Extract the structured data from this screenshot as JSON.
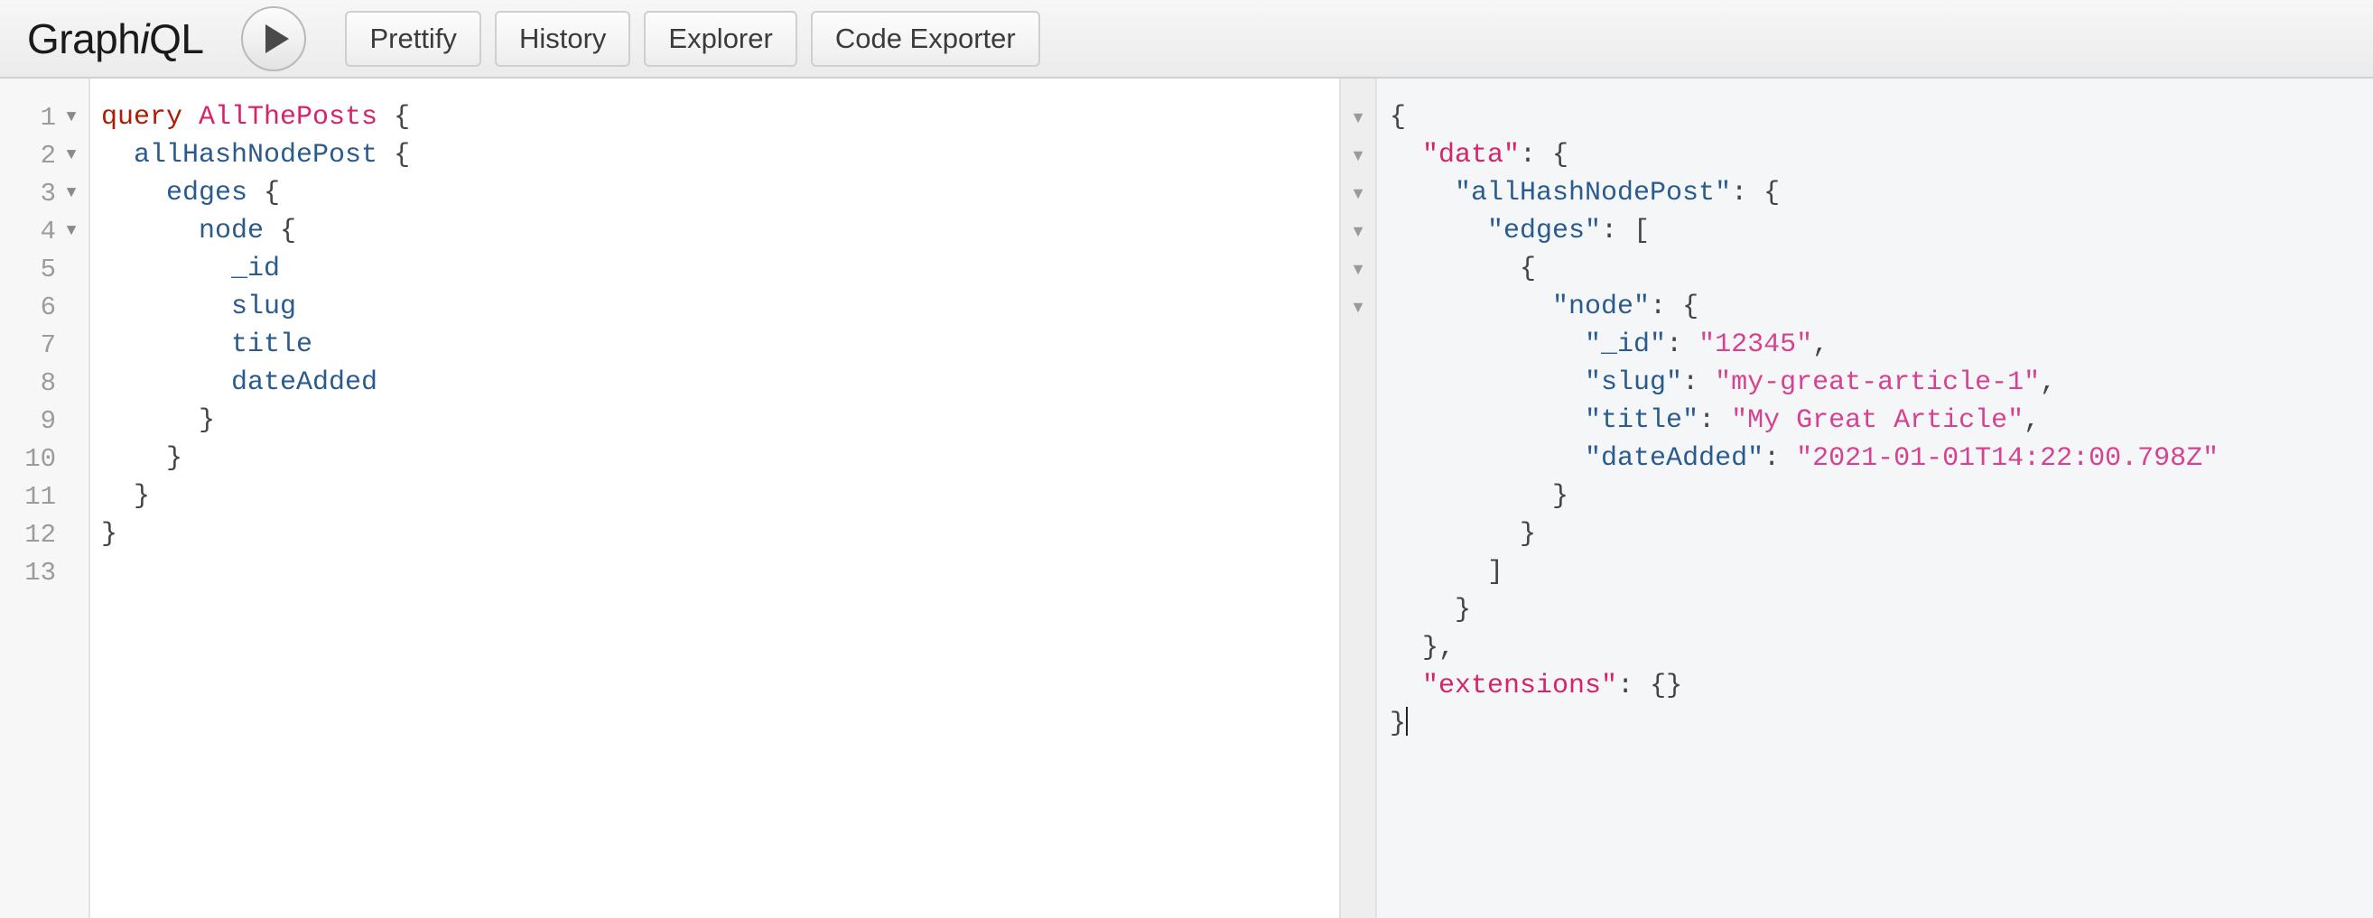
{
  "app": {
    "brand_prefix": "Graph",
    "brand_italic": "i",
    "brand_suffix": "QL"
  },
  "toolbar": {
    "execute_icon": "play-triangle-icon",
    "buttons": [
      {
        "label": "Prettify"
      },
      {
        "label": "History"
      },
      {
        "label": "Explorer"
      },
      {
        "label": "Code Exporter"
      }
    ]
  },
  "colors": {
    "keyword": "#b11a04",
    "operation_name": "#d6236a",
    "field": "#2a5b8f",
    "punctuation": "#444444",
    "json_top_key": "#d6236a",
    "json_nested_key": "#2a5b8f",
    "json_string": "#d64292",
    "header_bg": "#f2f2f2",
    "query_bg": "#ffffff",
    "result_bg": "#f5f6f8"
  },
  "query_editor": {
    "line_numbers": [
      "1",
      "2",
      "3",
      "4",
      "5",
      "6",
      "7",
      "8",
      "9",
      "10",
      "11",
      "12",
      "13"
    ],
    "fold_markers": [
      "▼",
      "▼",
      "▼",
      "▼",
      "",
      "",
      "",
      "",
      "",
      "",
      "",
      "",
      ""
    ],
    "lines": [
      [
        {
          "t": "query",
          "c": "kw"
        },
        {
          "t": " ",
          "c": "pn"
        },
        {
          "t": "AllThePosts",
          "c": "op"
        },
        {
          "t": " {",
          "c": "pn"
        }
      ],
      [
        {
          "t": "  ",
          "c": "pn"
        },
        {
          "t": "allHashNodePost",
          "c": "fld"
        },
        {
          "t": " {",
          "c": "pn"
        }
      ],
      [
        {
          "t": "    ",
          "c": "pn"
        },
        {
          "t": "edges",
          "c": "fld"
        },
        {
          "t": " {",
          "c": "pn"
        }
      ],
      [
        {
          "t": "      ",
          "c": "pn"
        },
        {
          "t": "node",
          "c": "fld"
        },
        {
          "t": " {",
          "c": "pn"
        }
      ],
      [
        {
          "t": "        ",
          "c": "pn"
        },
        {
          "t": "_id",
          "c": "fld"
        }
      ],
      [
        {
          "t": "        ",
          "c": "pn"
        },
        {
          "t": "slug",
          "c": "fld"
        }
      ],
      [
        {
          "t": "        ",
          "c": "pn"
        },
        {
          "t": "title",
          "c": "fld"
        }
      ],
      [
        {
          "t": "        ",
          "c": "pn"
        },
        {
          "t": "dateAdded",
          "c": "fld"
        }
      ],
      [
        {
          "t": "      }",
          "c": "pn"
        }
      ],
      [
        {
          "t": "    }",
          "c": "pn"
        }
      ],
      [
        {
          "t": "  }",
          "c": "pn"
        }
      ],
      [
        {
          "t": "}",
          "c": "pn"
        }
      ],
      []
    ],
    "plain_text": "query AllThePosts {\n  allHashNodePost {\n    edges {\n      node {\n        _id\n        slug\n        title\n        dateAdded\n      }\n    }\n  }\n}\n"
  },
  "result_viewer": {
    "fold_markers": [
      "▼",
      "▼",
      "▼",
      "▼",
      "▼",
      "▼",
      "",
      "",
      "",
      "",
      "",
      "",
      "",
      "",
      "",
      "",
      "",
      ""
    ],
    "lines": [
      [
        {
          "t": "{",
          "c": "rp"
        }
      ],
      [
        {
          "t": "  ",
          "c": "rp"
        },
        {
          "t": "\"data\"",
          "c": "key1"
        },
        {
          "t": ": {",
          "c": "rp"
        }
      ],
      [
        {
          "t": "    ",
          "c": "rp"
        },
        {
          "t": "\"allHashNodePost\"",
          "c": "key2"
        },
        {
          "t": ": {",
          "c": "rp"
        }
      ],
      [
        {
          "t": "      ",
          "c": "rp"
        },
        {
          "t": "\"edges\"",
          "c": "key2"
        },
        {
          "t": ": [",
          "c": "rp"
        }
      ],
      [
        {
          "t": "        {",
          "c": "rp"
        }
      ],
      [
        {
          "t": "          ",
          "c": "rp"
        },
        {
          "t": "\"node\"",
          "c": "key2"
        },
        {
          "t": ": {",
          "c": "rp"
        }
      ],
      [
        {
          "t": "            ",
          "c": "rp"
        },
        {
          "t": "\"_id\"",
          "c": "key2"
        },
        {
          "t": ": ",
          "c": "rp"
        },
        {
          "t": "\"12345\"",
          "c": "str"
        },
        {
          "t": ",",
          "c": "rp"
        }
      ],
      [
        {
          "t": "            ",
          "c": "rp"
        },
        {
          "t": "\"slug\"",
          "c": "key2"
        },
        {
          "t": ": ",
          "c": "rp"
        },
        {
          "t": "\"my-great-article-1\"",
          "c": "str"
        },
        {
          "t": ",",
          "c": "rp"
        }
      ],
      [
        {
          "t": "            ",
          "c": "rp"
        },
        {
          "t": "\"title\"",
          "c": "key2"
        },
        {
          "t": ": ",
          "c": "rp"
        },
        {
          "t": "\"My Great Article\"",
          "c": "str"
        },
        {
          "t": ",",
          "c": "rp"
        }
      ],
      [
        {
          "t": "            ",
          "c": "rp"
        },
        {
          "t": "\"dateAdded\"",
          "c": "key2"
        },
        {
          "t": ": ",
          "c": "rp"
        },
        {
          "t": "\"2021-01-01T14:22:00.798Z\"",
          "c": "str"
        }
      ],
      [
        {
          "t": "          }",
          "c": "rp"
        }
      ],
      [
        {
          "t": "        }",
          "c": "rp"
        }
      ],
      [
        {
          "t": "      ]",
          "c": "rp"
        }
      ],
      [
        {
          "t": "    }",
          "c": "rp"
        }
      ],
      [
        {
          "t": "  },",
          "c": "rp"
        }
      ],
      [
        {
          "t": "  ",
          "c": "rp"
        },
        {
          "t": "\"extensions\"",
          "c": "key1"
        },
        {
          "t": ": {}",
          "c": "rp"
        }
      ],
      [
        {
          "t": "}",
          "c": "rp"
        },
        {
          "t": "CARET",
          "c": "caret"
        }
      ]
    ],
    "plain_text": "{\n  \"data\": {\n    \"allHashNodePost\": {\n      \"edges\": [\n        {\n          \"node\": {\n            \"_id\": \"12345\",\n            \"slug\": \"my-great-article-1\",\n            \"title\": \"My Great Article\",\n            \"dateAdded\": \"2021-01-01T14:22:00.798Z\"\n          }\n        }\n      ]\n    }\n  },\n  \"extensions\": {}\n}"
  }
}
